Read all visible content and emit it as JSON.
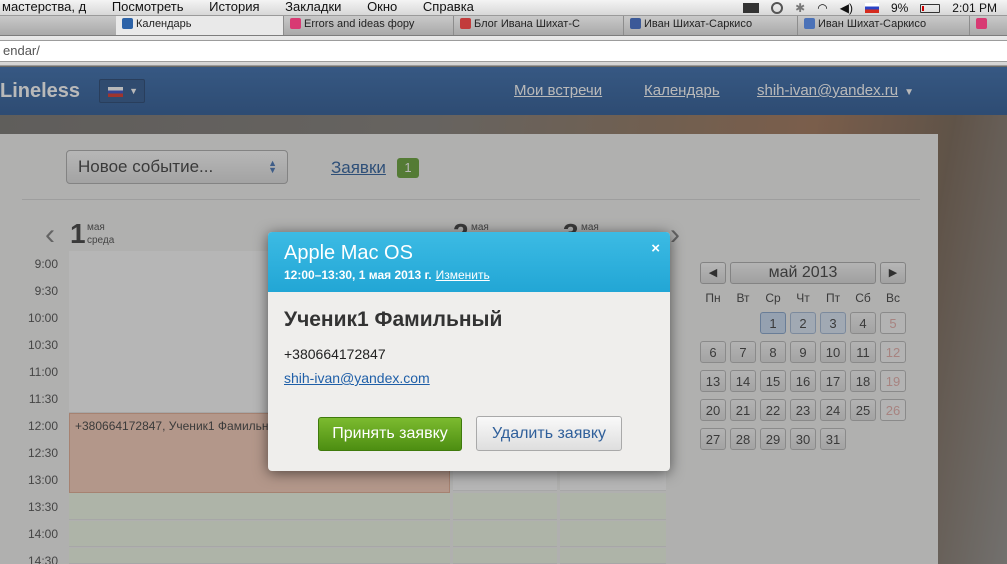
{
  "menubar": {
    "items": [
      "мастерства, д",
      "Посмотреть",
      "История",
      "Закладки",
      "Окно",
      "Справка"
    ],
    "battery": "9%",
    "clock": "2:01 PM"
  },
  "tabs": [
    "Календарь",
    "Errors and ideas фору",
    "Блог Ивана Шихат-С",
    "Иван Шихат-Саркисо",
    "Иван Шихат-Саркисо"
  ],
  "address": {
    "url": "endar/"
  },
  "site": {
    "logo": "Lineless",
    "nav": {
      "meetings": "Мои встречи",
      "calendar": "Календарь",
      "user": "shih-ivan@yandex.ru"
    }
  },
  "toolbar": {
    "new_event": "Новое событие...",
    "requests_label": "Заявки",
    "requests_count": "1"
  },
  "calendar": {
    "days": [
      {
        "num": "1",
        "month": "мая",
        "weekday": "среда"
      },
      {
        "num": "2",
        "month": "мая",
        "weekday": ""
      },
      {
        "num": "3",
        "month": "мая",
        "weekday": ""
      }
    ],
    "hours": [
      "9:00",
      "9:30",
      "10:00",
      "10:30",
      "11:00",
      "11:30",
      "12:00",
      "12:30",
      "13:00",
      "13:30",
      "14:00",
      "14:30"
    ],
    "event_text": "+380664172847, Ученик1 Фамильный"
  },
  "mini": {
    "month": "май 2013",
    "prev": "◀",
    "next": "▶",
    "weekdays": [
      "Пн",
      "Вт",
      "Ср",
      "Чт",
      "Пт",
      "Сб",
      "Вс"
    ],
    "weeks": [
      [
        "",
        "",
        "1",
        "2",
        "3",
        "4",
        "5"
      ],
      [
        "6",
        "7",
        "8",
        "9",
        "10",
        "11",
        "12"
      ],
      [
        "13",
        "14",
        "15",
        "16",
        "17",
        "18",
        "19"
      ],
      [
        "20",
        "21",
        "22",
        "23",
        "24",
        "25",
        "26"
      ],
      [
        "27",
        "28",
        "29",
        "30",
        "31",
        "",
        ""
      ]
    ]
  },
  "modal": {
    "title": "Apple Mac OS",
    "time": "12:00–13:30, 1 мая 2013 г.",
    "change": "Изменить",
    "close": "×",
    "name": "Ученик1 Фамильный",
    "phone": "+380664172847",
    "email": "shih-ivan@yandex.com",
    "accept": "Принять заявку",
    "delete": "Удалить заявку"
  }
}
